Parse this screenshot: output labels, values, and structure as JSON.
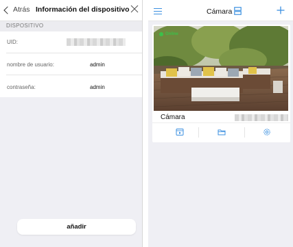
{
  "left_panel": {
    "back_label": "Atrás",
    "title": "Información del dispositivo",
    "section": "DISPOSITIVO",
    "rows": [
      {
        "label": "UID:",
        "value": ""
      },
      {
        "label": "nombre de usuario:",
        "value": "admin"
      },
      {
        "label": "contraseña:",
        "value": "admin"
      }
    ],
    "add_button": "añadir"
  },
  "right_panel": {
    "title": "Cámara",
    "camera": {
      "status": "Online",
      "name": "Cámara"
    }
  },
  "colors": {
    "accent": "#3a8fe0",
    "online": "#3bc14a"
  },
  "icons": [
    "back-chevron-icon",
    "close-icon",
    "menu-icon",
    "layout-icon",
    "plus-icon",
    "playback-icon",
    "folder-icon",
    "settings-icon"
  ]
}
